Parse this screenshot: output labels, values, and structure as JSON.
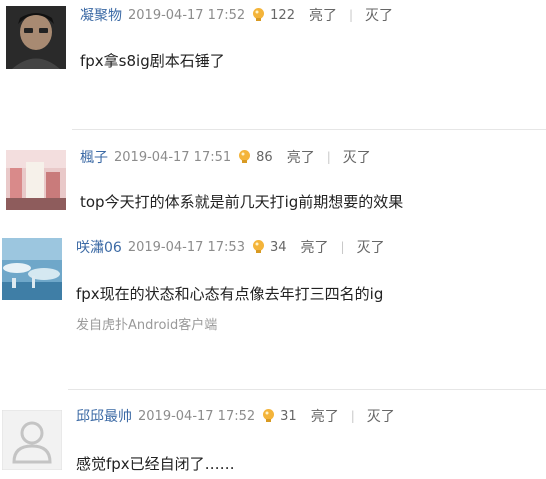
{
  "comments": [
    {
      "username": "凝聚物",
      "time": "2019-04-17 17:52",
      "likes": "122",
      "like_label": "亮了",
      "dislike_label": "灭了",
      "text": "fpx拿s8ig剧本石锤了"
    },
    {
      "username": "楓子",
      "time": "2019-04-17 17:51",
      "likes": "86",
      "like_label": "亮了",
      "dislike_label": "灭了",
      "text": "top今天打的体系就是前几天打ig前期想要的效果"
    },
    {
      "username": "咲瀟06",
      "time": "2019-04-17 17:53",
      "likes": "34",
      "like_label": "亮了",
      "dislike_label": "灭了",
      "text": "fpx现在的状态和心态有点像去年打三四名的ig",
      "source": "发自虎扑Android客户端"
    },
    {
      "username": "邱邱最帅",
      "time": "2019-04-17 17:52",
      "likes": "31",
      "like_label": "亮了",
      "dislike_label": "灭了",
      "text": "感觉fpx已经自闭了……"
    }
  ],
  "colors": {
    "username": "#3c6aa5",
    "meta": "#8c8c8c",
    "bulb": "#f4b43a"
  }
}
